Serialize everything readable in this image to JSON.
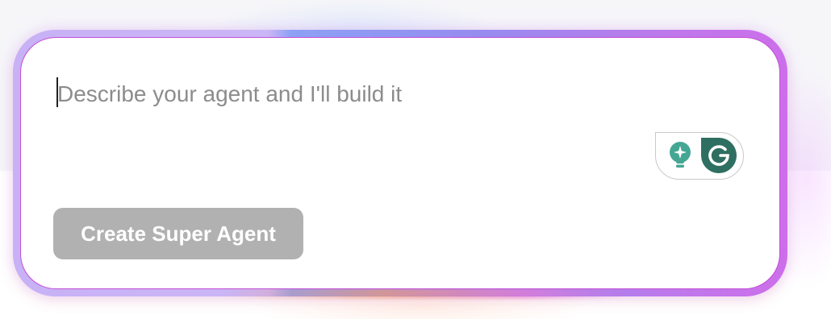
{
  "composer": {
    "placeholder": "Describe your agent and I'll build it",
    "value": ""
  },
  "grammarly_widget": {
    "icons": [
      "lightbulb-sparkle-icon",
      "grammarly-g-icon"
    ],
    "colors": {
      "bulb": "#45a793",
      "logo": "#2f6f62"
    }
  },
  "actions": {
    "create_label": "Create Super Agent",
    "create_enabled": false
  },
  "theme": {
    "frame_gradient": [
      "#c5adf5",
      "#8ca0f5",
      "#9a8cf0",
      "#cd6eeb"
    ],
    "button_disabled_bg": "#b1b1b1"
  }
}
